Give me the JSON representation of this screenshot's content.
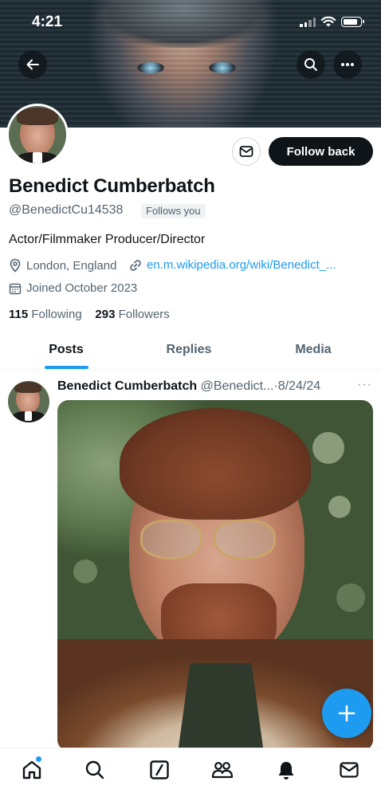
{
  "status_bar": {
    "time": "4:21"
  },
  "profile": {
    "name": "Benedict Cumberbatch",
    "handle": "@BenedictCu14538",
    "follows_you_badge": "Follows you",
    "follow_back_label": "Follow back",
    "bio": "Actor/Filmmaker Producer/Director",
    "location": "London, England",
    "website": "en.m.wikipedia.org/wiki/Benedict_...",
    "joined": "Joined October 2023",
    "following_count": "115",
    "following_label": "Following",
    "followers_count": "293",
    "followers_label": "Followers"
  },
  "tabs": [
    {
      "label": "Posts",
      "active": true
    },
    {
      "label": "Replies",
      "active": false
    },
    {
      "label": "Media",
      "active": false
    }
  ],
  "post": {
    "author_name": "Benedict Cumberbatch",
    "author_handle": "@Benedict...",
    "separator": "·",
    "date": "8/24/24",
    "more": "···"
  },
  "icons": {
    "back": "arrow-left-icon",
    "search": "search-icon",
    "more": "more-icon",
    "message": "mail-icon",
    "location": "location-pin-icon",
    "link": "link-icon",
    "calendar": "calendar-icon",
    "compose": "plus-icon",
    "nav": [
      "home-icon",
      "search-icon",
      "grok-icon",
      "communities-icon",
      "notifications-icon",
      "messages-icon"
    ]
  },
  "colors": {
    "accent": "#1d9bf0",
    "text": "#0f1419",
    "secondary": "#536471"
  }
}
